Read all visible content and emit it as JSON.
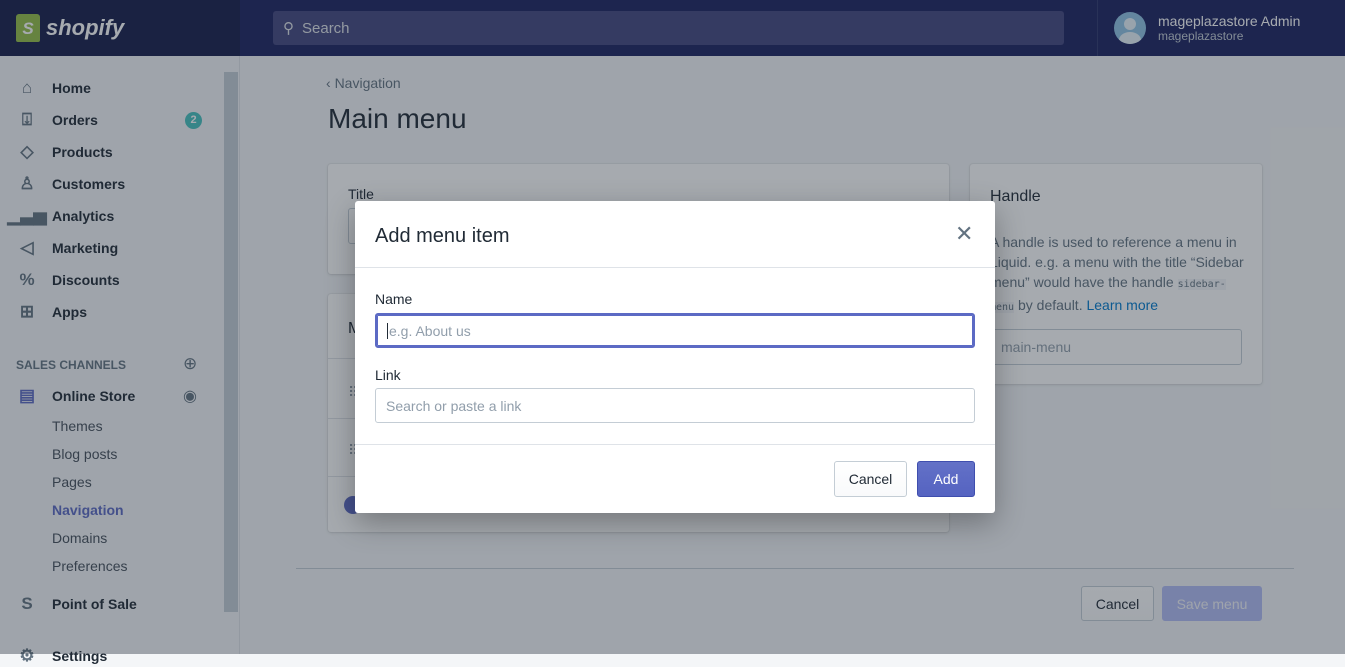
{
  "topbar": {
    "logo": "shopify",
    "search_placeholder": "Search",
    "user_name": "mageplazastore Admin",
    "store_name": "mageplazastore"
  },
  "sidebar": {
    "items": [
      {
        "label": "Home",
        "icon": "home-icon"
      },
      {
        "label": "Orders",
        "icon": "orders-icon",
        "badge": "2"
      },
      {
        "label": "Products",
        "icon": "tag-icon"
      },
      {
        "label": "Customers",
        "icon": "person-icon"
      },
      {
        "label": "Analytics",
        "icon": "bar-chart-icon"
      },
      {
        "label": "Marketing",
        "icon": "megaphone-icon"
      },
      {
        "label": "Discounts",
        "icon": "discount-icon"
      },
      {
        "label": "Apps",
        "icon": "apps-icon"
      }
    ],
    "section_label": "SALES CHANNELS",
    "online_store": "Online Store",
    "sub_items": [
      "Themes",
      "Blog posts",
      "Pages",
      "Navigation",
      "Domains",
      "Preferences"
    ],
    "active_sub": "Navigation",
    "point_of_sale": "Point of Sale",
    "settings": "Settings"
  },
  "page": {
    "breadcrumb": "Navigation",
    "title": "Main menu",
    "title_label": "Title",
    "menu_items_label": "M",
    "handle": {
      "heading": "Handle",
      "text1": "A handle is used to reference a menu in Liquid. e.g. a menu with the title “Sidebar menu” would have the handle ",
      "code": "sidebar-menu",
      "text2": " by default. ",
      "learn_more": "Learn more",
      "value": "main-menu"
    },
    "cancel": "Cancel",
    "save": "Save menu"
  },
  "modal": {
    "title": "Add menu item",
    "name_label": "Name",
    "name_placeholder": "e.g. About us",
    "link_label": "Link",
    "link_placeholder": "Search or paste a link",
    "cancel": "Cancel",
    "add": "Add"
  },
  "colors": {
    "accent": "#5c6ac4",
    "topbar": "#1c2260",
    "badge": "#47c1bf"
  }
}
